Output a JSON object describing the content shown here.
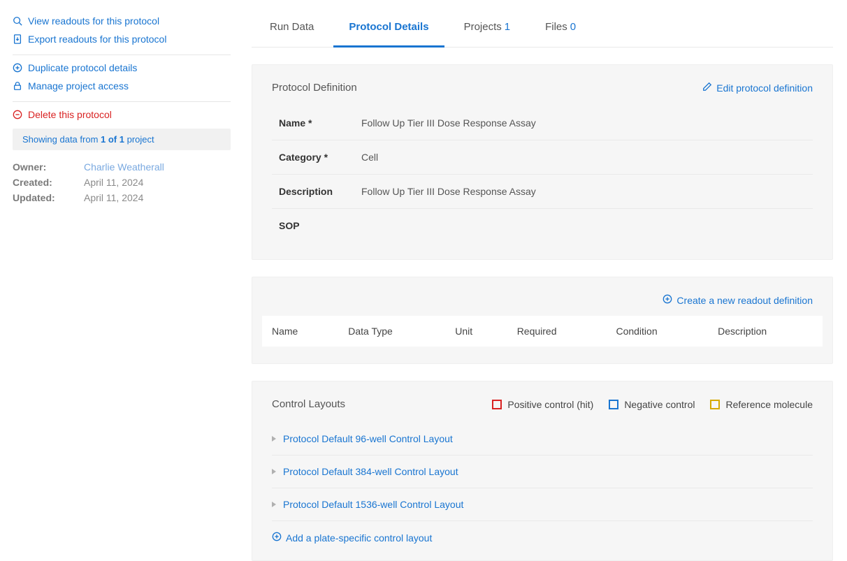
{
  "sidebar": {
    "actions": {
      "view_readouts": "View readouts for this protocol",
      "export_readouts": "Export readouts for this protocol",
      "duplicate": "Duplicate protocol details",
      "manage_access": "Manage project access",
      "delete": "Delete this protocol"
    },
    "showing_data": {
      "prefix": "Showing data from ",
      "bold": "1 of 1",
      "suffix": " project"
    },
    "meta": {
      "owner_label": "Owner:",
      "owner_value": "Charlie Weatherall",
      "created_label": "Created:",
      "created_value": "April 11, 2024",
      "updated_label": "Updated:",
      "updated_value": "April 11, 2024"
    }
  },
  "tabs": {
    "run_data": "Run Data",
    "protocol_details": "Protocol Details",
    "projects": "Projects",
    "projects_count": "1",
    "files": "Files",
    "files_count": "0"
  },
  "definition": {
    "title": "Protocol Definition",
    "edit_label": "Edit protocol definition",
    "rows": {
      "name_label": "Name *",
      "name_value": "Follow Up Tier III Dose Response Assay",
      "category_label": "Category *",
      "category_value": "Cell",
      "description_label": "Description",
      "description_value": "Follow Up Tier III Dose Response Assay",
      "sop_label": "SOP",
      "sop_value": ""
    }
  },
  "readouts": {
    "create_label": "Create a new readout definition",
    "headers": {
      "name": "Name",
      "data_type": "Data Type",
      "unit": "Unit",
      "required": "Required",
      "condition": "Condition",
      "description": "Description"
    }
  },
  "control_layouts": {
    "title": "Control Layouts",
    "legend": {
      "positive": "Positive control (hit)",
      "negative": "Negative control",
      "reference": "Reference molecule"
    },
    "items": [
      "Protocol Default 96-well Control Layout",
      "Protocol Default 384-well Control Layout",
      "Protocol Default 1536-well Control Layout"
    ],
    "add_label": "Add a plate-specific control layout"
  }
}
